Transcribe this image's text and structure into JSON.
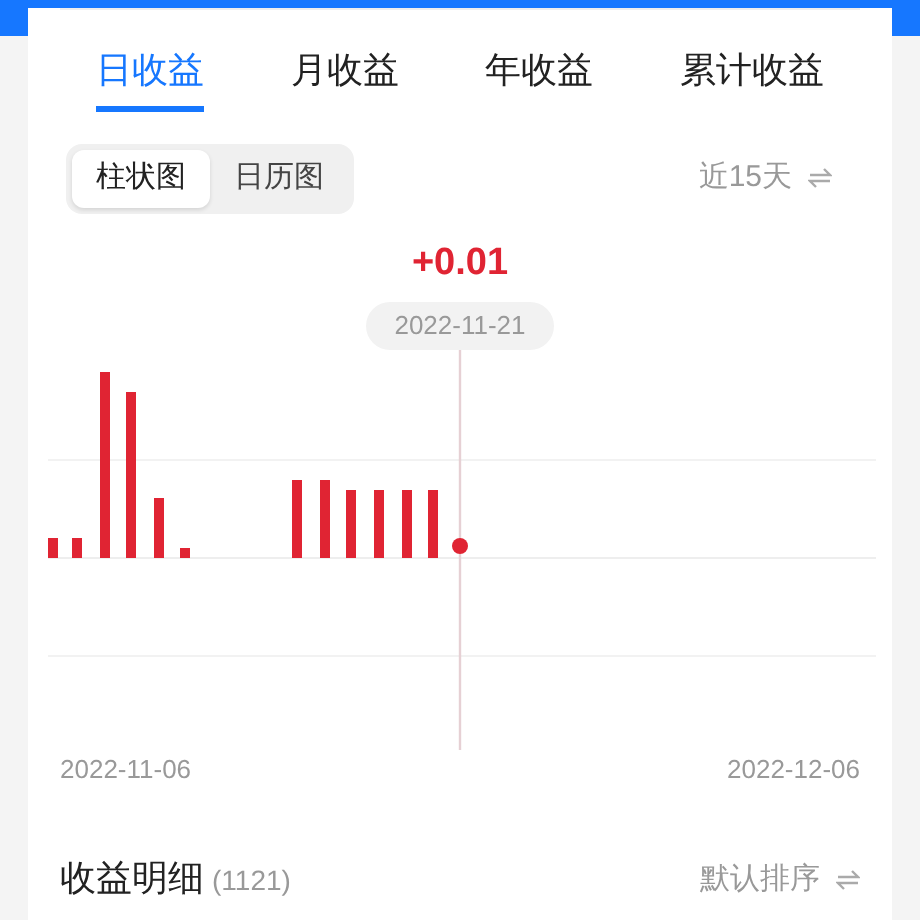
{
  "tabs": [
    {
      "label": "日收益",
      "selected": true
    },
    {
      "label": "月收益",
      "selected": false
    },
    {
      "label": "年收益",
      "selected": false
    },
    {
      "label": "累计收益",
      "selected": false
    }
  ],
  "view_toggle": [
    {
      "label": "柱状图",
      "selected": true
    },
    {
      "label": "日历图",
      "selected": false
    }
  ],
  "range": {
    "label": "近15天"
  },
  "selected_point": {
    "value": "+0.01",
    "date": "2022-11-21"
  },
  "chart": {
    "start_date": "2022-11-06",
    "end_date": "2022-12-06"
  },
  "details": {
    "title": "收益明细",
    "count": "(1121)",
    "sort_label": "默认排序"
  }
}
